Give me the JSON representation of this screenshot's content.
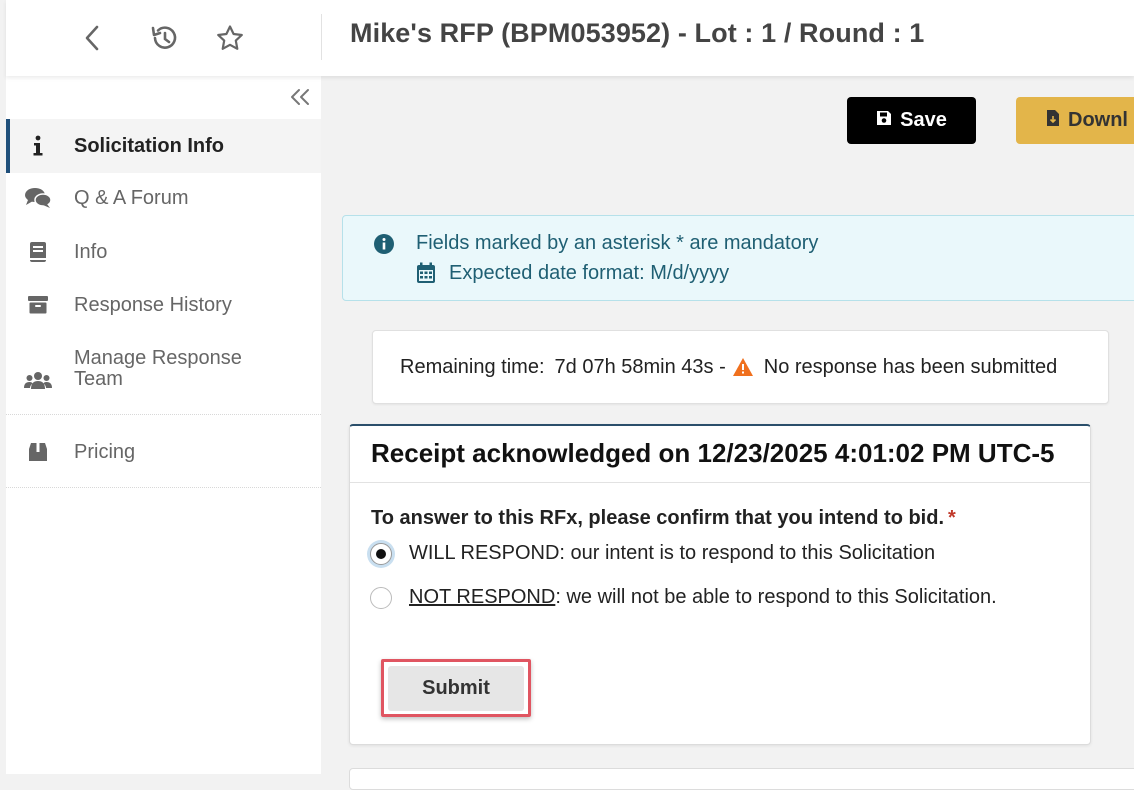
{
  "header": {
    "title": "Mike's RFP (BPM053952) - Lot : 1 / Round : 1",
    "icons": [
      "chevron-left-icon",
      "history-icon",
      "star-icon"
    ]
  },
  "sidebar": {
    "items": [
      {
        "label": "Solicitation Info",
        "icon": "info-icon",
        "active": true
      },
      {
        "label": "Q & A Forum",
        "icon": "comments-icon"
      },
      {
        "label": "Info",
        "icon": "book-icon"
      },
      {
        "label": "Response History",
        "icon": "archive-icon"
      },
      {
        "label": "Manage Response Team",
        "icon": "users-icon"
      },
      {
        "label": "Pricing",
        "icon": "box-icon"
      }
    ]
  },
  "toolbar": {
    "save_label": "Save",
    "download_label": "Downl"
  },
  "notice": {
    "mandatory": "Fields marked by an asterisk * are mandatory",
    "date_format": "Expected date format: M/d/yyyy"
  },
  "status": {
    "remaining_label": "Remaining time:",
    "remaining_value": "7d 07h 58min 43s -",
    "message": "No response has been submitted"
  },
  "acknowledgement": {
    "title": "Receipt acknowledged on 12/23/2025 4:01:02 PM UTC-5",
    "question": "To answer to this RFx, please confirm that you intend to bid.",
    "required_mark": "*",
    "options": [
      {
        "key": "WILL RESPOND",
        "text": ": our intent is to respond to this Solicitation",
        "selected": true
      },
      {
        "key": "NOT RESPOND",
        "text": ": we will not be able to respond to this Solicitation.",
        "selected": false
      }
    ],
    "submit_label": "Submit"
  },
  "colors": {
    "active_bar": "#1f4f7a",
    "save_bg": "#000000",
    "download_bg": "#e3b54a",
    "info_bg": "#eaf8fb",
    "warning": "#f0701e",
    "highlight": "#e05561"
  }
}
